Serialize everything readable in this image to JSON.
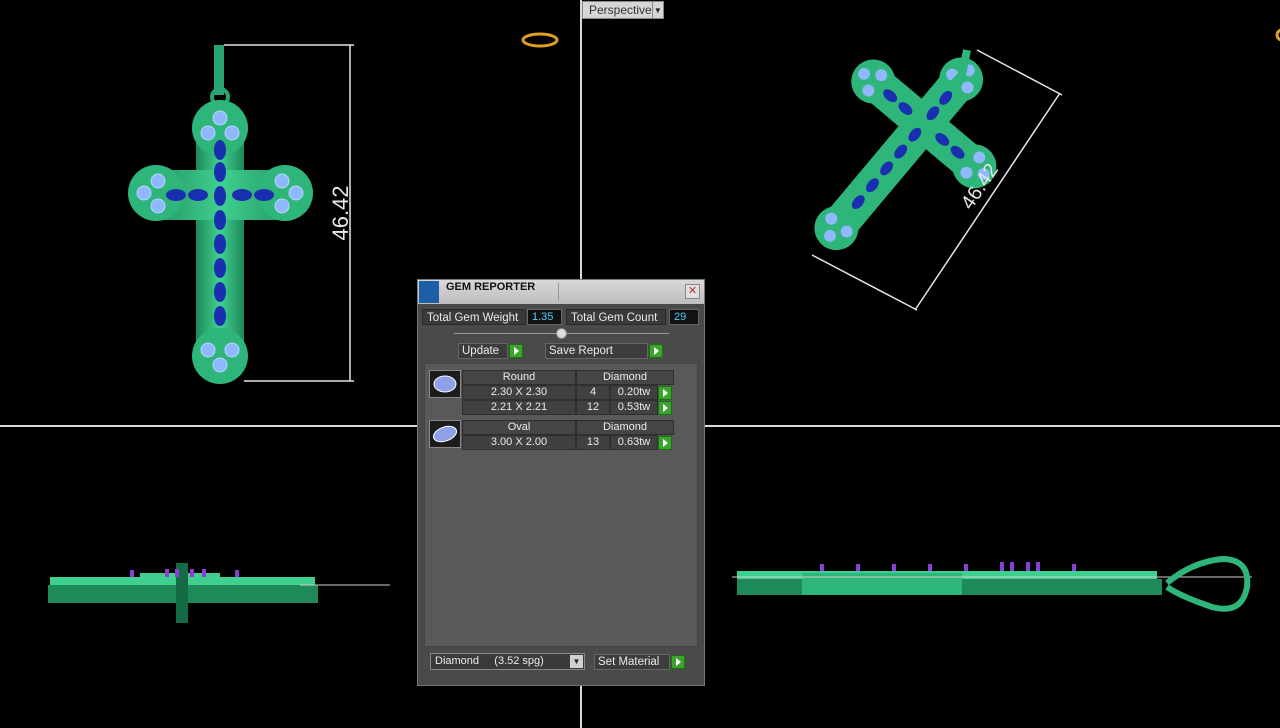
{
  "viewport_top_right": {
    "view_label": "Perspective"
  },
  "dimensions": {
    "front_view_height": "46.42",
    "perspective_length": "46.42"
  },
  "gem_reporter": {
    "title": "GEM REPORTER",
    "total_weight_label": "Total Gem Weight",
    "total_weight_value": "1.35",
    "total_count_label": "Total Gem Count",
    "total_count_value": "29",
    "update_label": "Update",
    "save_report_label": "Save Report",
    "groups": [
      {
        "shape": "Round",
        "material": "Diamond",
        "rows": [
          {
            "size": "2.30 X 2.30",
            "count": "4",
            "weight": "0.20tw"
          },
          {
            "size": "2.21 X 2.21",
            "count": "12",
            "weight": "0.53tw"
          }
        ]
      },
      {
        "shape": "Oval",
        "material": "Diamond",
        "rows": [
          {
            "size": "3.00 X 2.00",
            "count": "13",
            "weight": "0.63tw"
          }
        ]
      }
    ],
    "material_select_value": "Diamond     (3.52 spg)",
    "set_material_label": "Set Material"
  },
  "colors": {
    "metal": "#2fb87a",
    "gem_blue": "#1a2fb0",
    "round_gem": "#8fb8ff",
    "dimension_line": "#e6e6e6",
    "value_text": "#4ad0ff",
    "go_button": "#3aa52a"
  },
  "icons": {
    "close": "close-icon",
    "go": "play-arrow-icon",
    "dropdown": "chevron-down-icon",
    "round_gem": "round-gem-icon",
    "oval_gem": "oval-gem-icon"
  }
}
